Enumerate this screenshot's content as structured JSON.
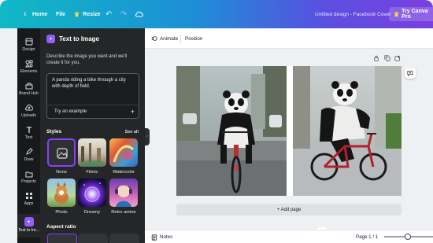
{
  "topbar": {
    "home_label": "Home",
    "file_label": "File",
    "resize_label": "Resize",
    "doc_title": "Untitled design - Facebook Cover",
    "try_pro_label": "Try Canva Pro"
  },
  "rail": {
    "items": [
      {
        "label": "Design",
        "icon": "design-icon"
      },
      {
        "label": "Elements",
        "icon": "elements-icon"
      },
      {
        "label": "Brand Hub",
        "icon": "brand-hub-icon"
      },
      {
        "label": "Uploads",
        "icon": "uploads-icon"
      },
      {
        "label": "Text",
        "icon": "text-icon"
      },
      {
        "label": "Draw",
        "icon": "draw-icon"
      },
      {
        "label": "Projects",
        "icon": "projects-icon"
      },
      {
        "label": "Apps",
        "icon": "apps-icon"
      },
      {
        "label": "Text to Im...",
        "icon": "text-to-image-icon"
      }
    ]
  },
  "panel": {
    "title": "Text to Image",
    "description": "Describe the image you want and we'll create it for you.",
    "prompt_value": "A panda riding a bike through a city with depth of field.",
    "try_example_label": "Try an example",
    "styles_title": "Styles",
    "see_all_label": "See all",
    "styles": [
      {
        "label": "None"
      },
      {
        "label": "Filmic"
      },
      {
        "label": "Watercolor"
      },
      {
        "label": "Photo"
      },
      {
        "label": "Dreamy"
      },
      {
        "label": "Retro anime"
      }
    ],
    "aspect_title": "Aspect ratio"
  },
  "toolbar": {
    "animate_label": "Animate",
    "position_label": "Position"
  },
  "canvas": {
    "add_page_label": "+ Add page"
  },
  "bottombar": {
    "notes_label": "Notes",
    "page_indicator": "Page 1 / 1"
  },
  "colors": {
    "brand_gradient_start": "#0fb9c4",
    "brand_gradient_end": "#7a3fe0",
    "panel_bg": "#252627",
    "rail_bg": "#18191b",
    "selected_outline": "#8b3dff"
  }
}
